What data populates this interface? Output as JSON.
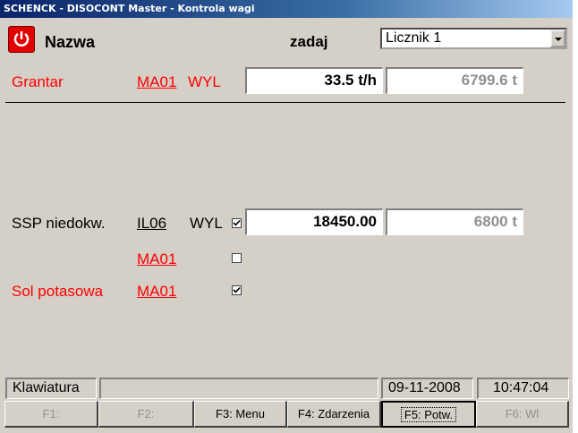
{
  "window": {
    "title": "SCHENCK - DISOCONT Master - Kontrola wagi"
  },
  "header": {
    "name_label": "Nazwa",
    "setpoint_label": "zadaj",
    "counter_select": "Licznik 1"
  },
  "rows": [
    {
      "name": "Grantar",
      "code": "MA01",
      "state": "WYL",
      "setpoint": "33.5 t/h",
      "counter": "6799.6 t"
    },
    {
      "name": "SSP niedokw.",
      "code": "IL06",
      "state": "WYL",
      "setpoint": "18450.00",
      "counter": "6800 t",
      "checked": true
    },
    {
      "name": "",
      "code": "MA01",
      "checked": false
    },
    {
      "name": "Sol potasowa",
      "code": "MA01",
      "checked": true
    }
  ],
  "status": {
    "input_mode": "Klawiatura",
    "message": "",
    "date": "09-11-2008",
    "time": "10:47:04"
  },
  "fkeys": [
    "F1:",
    "F2:",
    "F3: Menu",
    "F4: Zdarzenia",
    "F5: Potw.",
    "F6: Wl"
  ],
  "colors": {
    "accent_red": "#ff0000",
    "titlebar": "#0a246a",
    "background": "#d4d0c8"
  }
}
